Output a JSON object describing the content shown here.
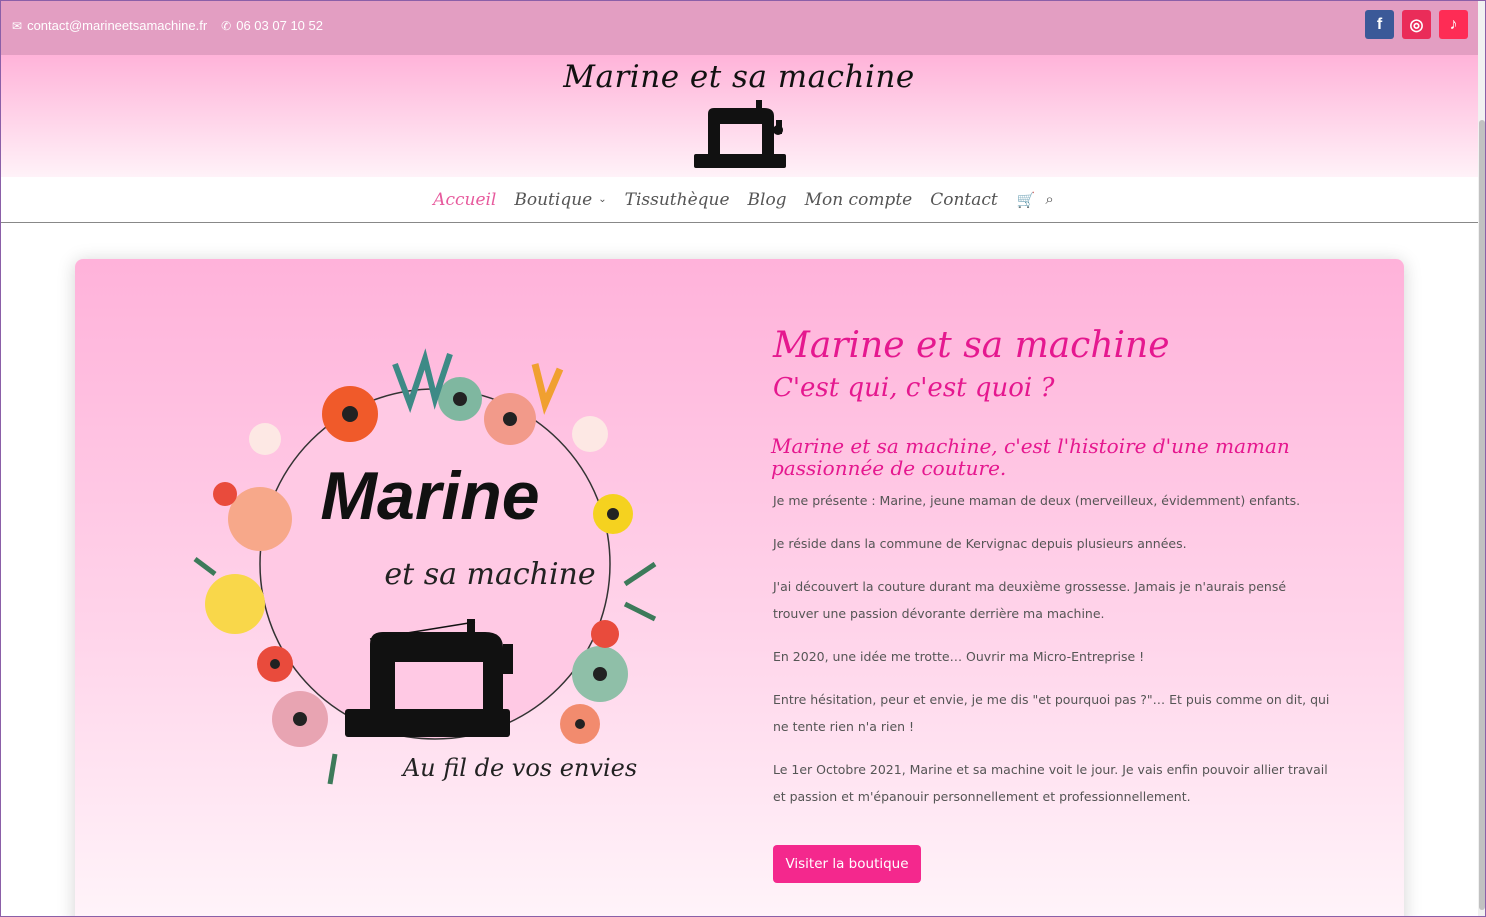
{
  "topbar": {
    "email": "contact@marineetsamachine.fr",
    "phone": "06 03 07 10 52",
    "socials": [
      {
        "name": "facebook-icon",
        "glyph": "f"
      },
      {
        "name": "instagram-icon",
        "glyph": "◎"
      },
      {
        "name": "tiktok-icon",
        "glyph": "♪"
      }
    ]
  },
  "header": {
    "site_title": "Marine et sa machine"
  },
  "nav": {
    "items": [
      {
        "label": "Accueil",
        "active": true
      },
      {
        "label": "Boutique",
        "has_dropdown": true
      },
      {
        "label": "Tissuthèque"
      },
      {
        "label": "Blog"
      },
      {
        "label": "Mon compte"
      },
      {
        "label": "Contact"
      }
    ],
    "cart_icon": "🛒",
    "search_icon": "⌕"
  },
  "hero": {
    "logo": {
      "line1": "Marine",
      "line2": "et sa machine",
      "tagline": "Au fil de vos envies"
    },
    "title": "Marine et sa machine",
    "subtitle": "C'est qui, c'est quoi ?",
    "heading": "Marine et sa machine, c'est l'histoire d'une maman passionnée de couture.",
    "paragraphs": [
      "Je me présente : Marine, jeune maman de deux (merveilleux, évidemment) enfants.",
      "Je réside dans la commune de Kervignac depuis plusieurs années.",
      "J'ai découvert la couture durant ma deuxième grossesse. Jamais je n'aurais pensé trouver une passion dévorante derrière ma machine.",
      "En 2020, une idée me trotte… Ouvrir ma Micro-Entreprise !",
      "Entre hésitation, peur et envie, je me dis \"et pourquoi pas ?\"… Et puis comme on dit, qui ne tente rien n'a rien !",
      "Le 1er Octobre 2021, Marine et sa machine voit le jour. Je vais enfin pouvoir allier travail et passion et m'épanouir personnellement et professionnellement."
    ],
    "cta_label": "Visiter la boutique"
  },
  "colors": {
    "topbar": "#e39ec2",
    "accent": "#e5188f",
    "button": "#f4288d",
    "nav_active": "#e75a9d"
  }
}
